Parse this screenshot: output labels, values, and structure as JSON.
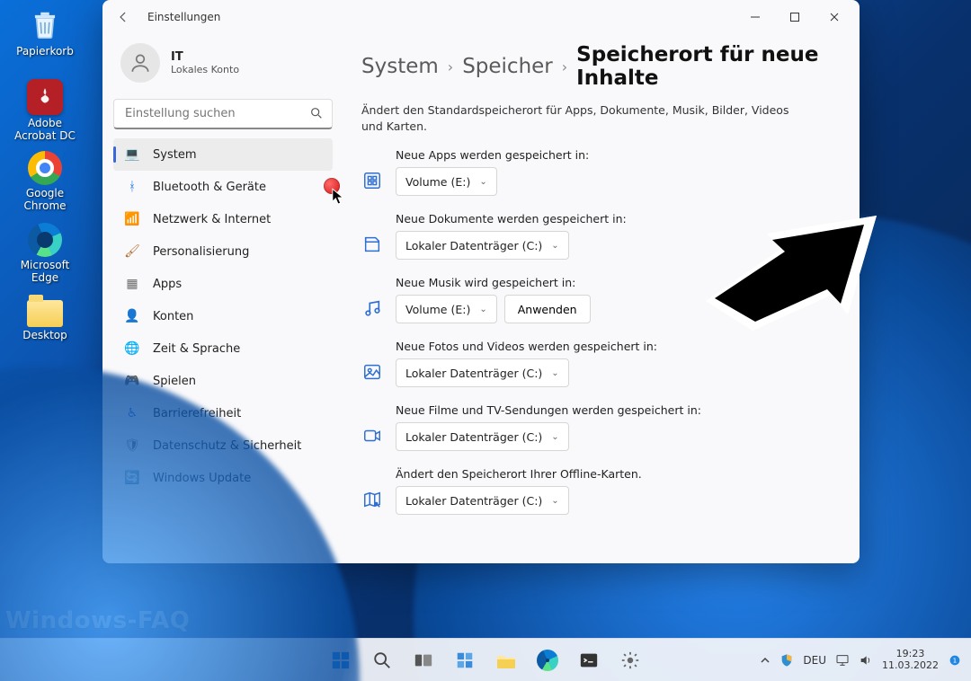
{
  "desktop": {
    "icons": [
      {
        "label": "Papierkorb"
      },
      {
        "label": "Adobe Acrobat DC"
      },
      {
        "label": "Google Chrome"
      },
      {
        "label": "Microsoft Edge"
      },
      {
        "label": "Desktop"
      }
    ]
  },
  "window": {
    "title": "Einstellungen",
    "profile": {
      "name": "IT",
      "subtitle": "Lokales Konto"
    },
    "search_placeholder": "Einstellung suchen",
    "nav": [
      {
        "label": "System",
        "icon": "💻",
        "color": "#0a6fd9",
        "active": true
      },
      {
        "label": "Bluetooth & Geräte",
        "icon": "ᚼ",
        "color": "#2a7de1"
      },
      {
        "label": "Netzwerk & Internet",
        "icon": "📶",
        "color": "#1fa0d8"
      },
      {
        "label": "Personalisierung",
        "icon": "🖌",
        "color": "#b06a2d"
      },
      {
        "label": "Apps",
        "icon": "▦",
        "color": "#6a6a6a"
      },
      {
        "label": "Konten",
        "icon": "👤",
        "color": "#2fa56a"
      },
      {
        "label": "Zeit & Sprache",
        "icon": "🌐",
        "color": "#3b8dc9"
      },
      {
        "label": "Spielen",
        "icon": "🎮",
        "color": "#7a7a7a"
      },
      {
        "label": "Barrierefreiheit",
        "icon": "♿",
        "color": "#3b68d9"
      },
      {
        "label": "Datenschutz & Sicherheit",
        "icon": "🛡",
        "color": "#6a6a6a"
      },
      {
        "label": "Windows Update",
        "icon": "🔄",
        "color": "#1f8bd6"
      }
    ],
    "breadcrumb": {
      "l1": "System",
      "l2": "Speicher",
      "l3": "Speicherort für neue Inhalte"
    },
    "description": "Ändert den Standardspeicherort für Apps, Dokumente, Musik, Bilder, Videos und Karten.",
    "settings": [
      {
        "label": "Neue Apps werden gespeichert in:",
        "value": "Volume (E:)",
        "icon": "apps"
      },
      {
        "label": "Neue Dokumente werden gespeichert in:",
        "value": "Lokaler Datenträger (C:)",
        "icon": "document"
      },
      {
        "label": "Neue Musik wird gespeichert in:",
        "value": "Volume (E:)",
        "icon": "music",
        "apply_label": "Anwenden"
      },
      {
        "label": "Neue Fotos und Videos werden gespeichert in:",
        "value": "Lokaler Datenträger (C:)",
        "icon": "photo"
      },
      {
        "label": "Neue Filme und TV-Sendungen werden gespeichert in:",
        "value": "Lokaler Datenträger (C:)",
        "icon": "video"
      },
      {
        "label": "Ändert den Speicherort Ihrer Offline-Karten.",
        "value": "Lokaler Datenträger (C:)",
        "icon": "map"
      }
    ]
  },
  "taskbar": {
    "lang": "DEU",
    "time": "19:23",
    "date": "11.03.2022"
  },
  "watermark": "Windows-FAQ"
}
